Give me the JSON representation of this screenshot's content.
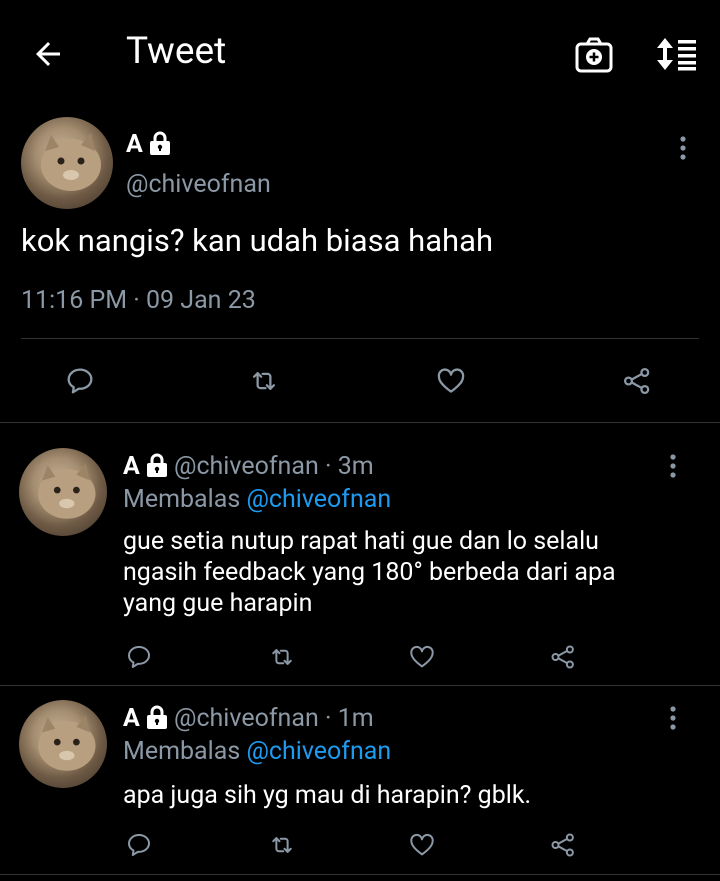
{
  "header": {
    "title": "Tweet",
    "back_icon": "arrow-left-icon",
    "camera_icon": "camera-plus-icon",
    "sort_icon": "sort-list-icon"
  },
  "main_tweet": {
    "display_name": "A",
    "handle": "@chiveofnan",
    "text": "kok nangis? kan udah biasa hahah",
    "timestamp": "11:16 PM · 09 Jan 23"
  },
  "replies": [
    {
      "display_name": "A",
      "handle": "@chiveofnan",
      "time": "· 3m",
      "replying_label": "Membalas",
      "replying_to": "@chiveofnan",
      "text_lines": [
        "gue setia nutup rapat hati gue dan lo selalu",
        "ngasih feedback yang 180° berbeda dari apa",
        "yang gue harapin"
      ]
    },
    {
      "display_name": "A",
      "handle": "@chiveofnan",
      "time": "· 1m",
      "replying_label": "Membalas",
      "replying_to": "@chiveofnan",
      "text_lines": [
        "apa juga sih yg mau di harapin? gblk."
      ]
    }
  ],
  "colors": {
    "background": "#000000",
    "text": "#ffffff",
    "muted": "#8b98a5",
    "link": "#1d9bf0",
    "divider": "#2f3336"
  }
}
